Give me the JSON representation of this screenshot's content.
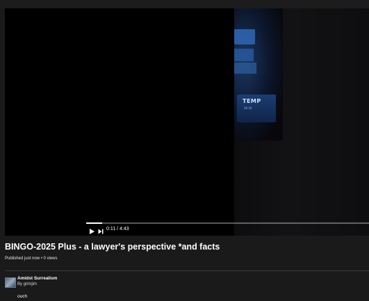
{
  "player": {
    "current_time": "0:11",
    "duration": "4:43",
    "time_display": "0:11 / 4:43",
    "progress_fraction": 0.057,
    "frame_screen_text": "TEMP",
    "frame_screen_subtext": "26.20"
  },
  "video": {
    "title": "BINGO-2025 Plus - a lawyer's perspective *and facts",
    "meta": "Published just now • 0 views"
  },
  "channel": {
    "name": "Amidst Surrealism",
    "by": "By grimjim"
  },
  "description": {
    "text": "ouch"
  },
  "colors": {
    "background": "#1a1a1a",
    "player_background": "#000000",
    "text": "#ffffff"
  },
  "icons": {
    "play": "play-icon",
    "next": "skip-next-icon"
  }
}
